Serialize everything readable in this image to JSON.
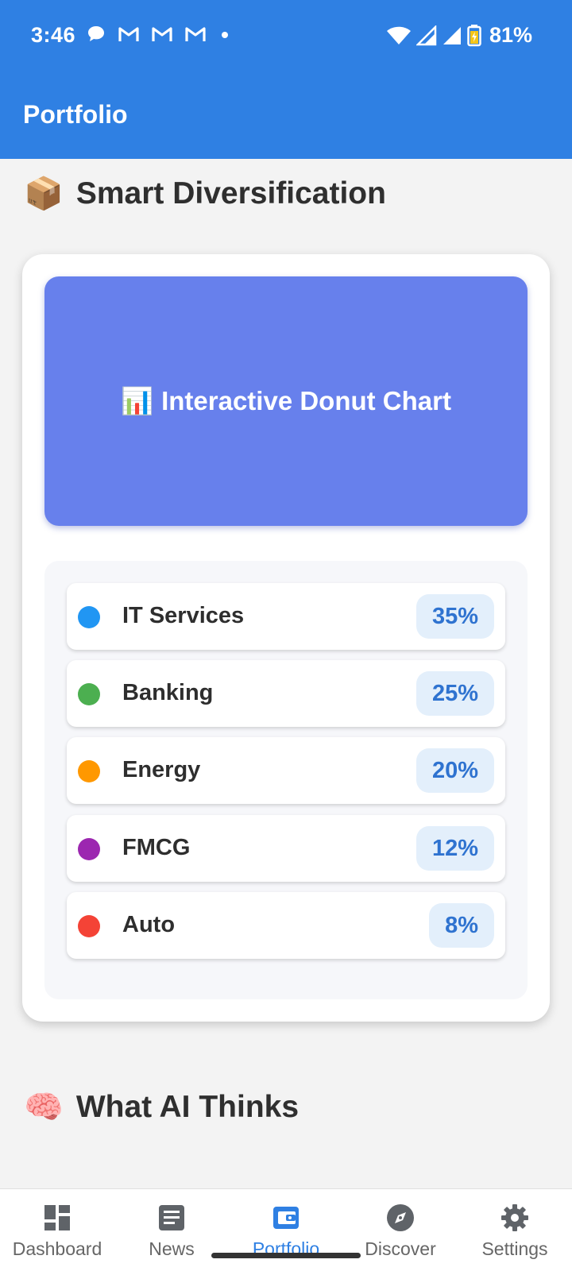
{
  "status_bar": {
    "time": "3:46",
    "battery": "81%",
    "notifications": [
      "chat-bubble-icon",
      "gmail-icon",
      "gmail-icon",
      "gmail-icon",
      "dot-icon"
    ]
  },
  "app_bar": {
    "title": "Portfolio"
  },
  "sections": {
    "diversification": {
      "emoji": "📦",
      "title": "Smart Diversification"
    },
    "ai": {
      "emoji": "🧠",
      "title": "What AI Thinks"
    }
  },
  "chart_placeholder": {
    "emoji": "📊",
    "label": "Interactive Donut Chart"
  },
  "allocation": [
    {
      "label": "IT Services",
      "percent": "35%",
      "color": "#2196F3"
    },
    {
      "label": "Banking",
      "percent": "25%",
      "color": "#4CAF50"
    },
    {
      "label": "Energy",
      "percent": "20%",
      "color": "#FF9800"
    },
    {
      "label": "FMCG",
      "percent": "12%",
      "color": "#9C27B0"
    },
    {
      "label": "Auto",
      "percent": "8%",
      "color": "#F44336"
    }
  ],
  "bottom_nav": [
    {
      "label": "Dashboard",
      "icon": "dashboard-icon"
    },
    {
      "label": "News",
      "icon": "news-icon"
    },
    {
      "label": "Portfolio",
      "icon": "wallet-icon",
      "active": true
    },
    {
      "label": "Discover",
      "icon": "compass-icon"
    },
    {
      "label": "Settings",
      "icon": "gear-icon"
    }
  ],
  "colors": {
    "primary": "#2f80e3",
    "chart_bg": "#6780ec"
  }
}
